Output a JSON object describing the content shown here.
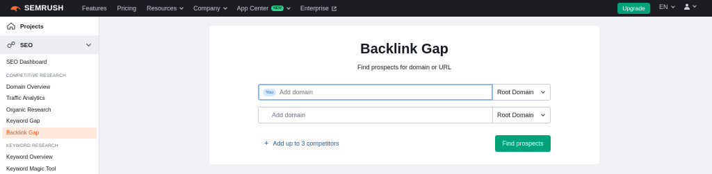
{
  "brand": {
    "name": "SEMRUSH",
    "accent": "#ff642d"
  },
  "topnav": {
    "items": [
      {
        "label": "Features",
        "has_dropdown": false
      },
      {
        "label": "Pricing",
        "has_dropdown": false
      },
      {
        "label": "Resources",
        "has_dropdown": true
      },
      {
        "label": "Company",
        "has_dropdown": true
      },
      {
        "label": "App Center",
        "badge": "NEW",
        "has_dropdown": true
      },
      {
        "label": "Enterprise",
        "external": true
      }
    ],
    "upgrade_label": "Upgrade",
    "language": "EN"
  },
  "sidebar": {
    "projects_label": "Projects",
    "seo_label": "SEO",
    "dashboard_label": "SEO Dashboard",
    "competitive_section": "COMPETITIVE RESEARCH",
    "competitive_items": [
      "Domain Overview",
      "Traffic Analytics",
      "Organic Research",
      "Keyword Gap",
      "Backlink Gap"
    ],
    "active_item": "Backlink Gap",
    "keyword_section": "KEYWORD RESEARCH",
    "keyword_items": [
      "Keyword Overview",
      "Keyword Magic Tool"
    ]
  },
  "main": {
    "title": "Backlink Gap",
    "subtitle": "Find prospects for domain or URL",
    "you_badge": "You",
    "domain_placeholder": "Add domain",
    "competitor_placeholder": "Add domain",
    "scope_value_1": "Root Domain",
    "scope_value_2": "Root Domain",
    "add_competitors_label": "Add up to 3 competitors",
    "find_button_label": "Find prospects"
  },
  "colors": {
    "primary_green": "#00a27a",
    "link_blue": "#1f5da8",
    "topbar_bg": "#1b1d23"
  }
}
